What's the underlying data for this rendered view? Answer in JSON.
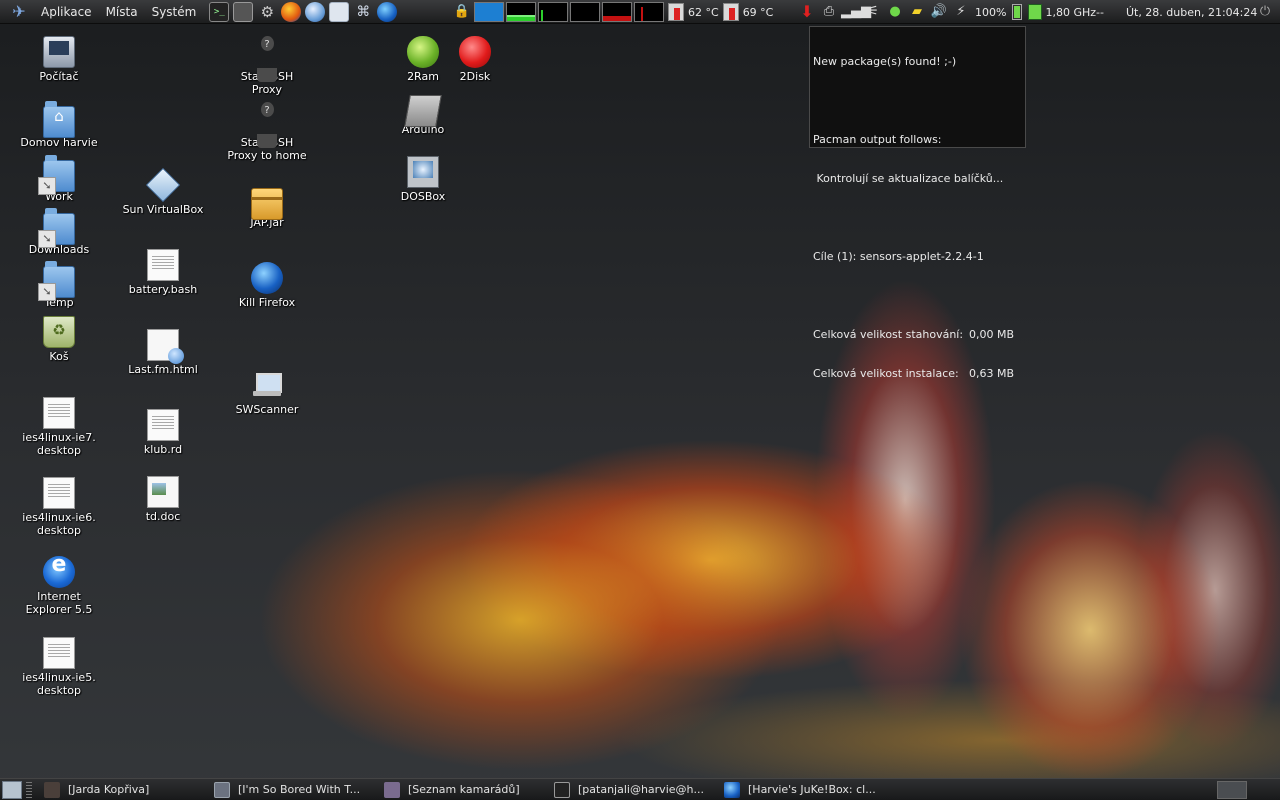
{
  "top_panel": {
    "menus": [
      "Aplikace",
      "Místa",
      "Systém"
    ],
    "launchers": [
      "terminal-icon",
      "system-monitor-icon",
      "settings-gear-icon",
      "firefox-icon",
      "network-globe-icon",
      "web-document-icon",
      "network-tools-icon",
      "earth-browser-icon"
    ],
    "temp1": "62 °C",
    "temp2": "69 °C",
    "battery": "100%",
    "cpu_freq": "1,80 GHz--",
    "clock": "Út, 28. duben, 21:04:24"
  },
  "notification": {
    "line1": "New package(s) found! ;-)",
    "line2": "Pacman output follows:",
    "line3": " Kontrolují se aktualizace balíčků...",
    "line4": "Cíle (1): sensors-applet-2.2.4-1",
    "download_label": "Celková velikost stahování:",
    "download_value": "0,00 MB",
    "install_label": "Celková velikost instalace:",
    "install_value": "0,63 MB"
  },
  "desktop": {
    "pocitac": "Počítač",
    "domov": "Domov harvie",
    "work": "Work",
    "downloads": "Downloads",
    "temp": "Temp",
    "kos": "Koš",
    "ie7": "ies4linux-ie7.\ndesktop",
    "ie6": "ies4linux-ie6.\ndesktop",
    "ie55": "Internet\nExplorer 5.5",
    "ie5": "ies4linux-ie5.\ndesktop",
    "virtualbox": "Sun VirtualBox",
    "battery_bash": "battery.bash",
    "lastfm": "Last.fm.html",
    "klub": "klub.rd",
    "tddoc": "td.doc",
    "ssh_proxy": "Start SSH\nProxy",
    "ssh_home": "Start SSH\nProxy to home",
    "jap": "JAP.jar",
    "kill_firefox": "Kill Firefox",
    "swscanner": "SWScanner",
    "ram": "2Ram",
    "disk": "2Disk",
    "arduino": "Arduino",
    "dosbox": "DOSBox"
  },
  "taskbar": {
    "tasks": [
      "[Jarda Kopřiva]",
      "[I'm So Bored With T...",
      "[Seznam kamarádů]",
      "[patanjali@harvie@h...",
      "[Harvie's JuKe!Box: cl..."
    ]
  }
}
